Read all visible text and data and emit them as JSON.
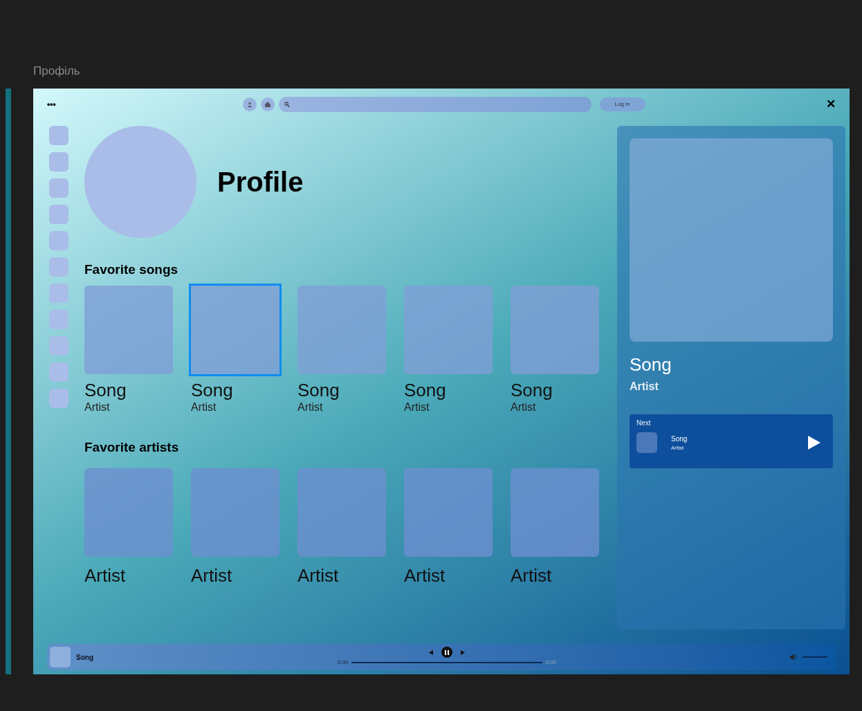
{
  "window": {
    "title": "Профіль"
  },
  "toolbar": {
    "menu": "•••",
    "login": "Log in",
    "close": "✕"
  },
  "sidebar": {
    "items": [
      {
        "selected": false
      },
      {
        "selected": false
      },
      {
        "selected": false
      },
      {
        "selected": false
      },
      {
        "selected": false
      },
      {
        "selected": false
      },
      {
        "selected": false
      },
      {
        "selected": false
      },
      {
        "selected": false
      },
      {
        "selected": false
      },
      {
        "selected": false
      }
    ]
  },
  "profile": {
    "title": "Profile"
  },
  "favorite_songs": {
    "heading": "Favorite songs",
    "items": [
      {
        "title": "Song",
        "artist": "Artist",
        "selected": false
      },
      {
        "title": "Song",
        "artist": "Artist",
        "selected": true
      },
      {
        "title": "Song",
        "artist": "Artist",
        "selected": false
      },
      {
        "title": "Song",
        "artist": "Artist",
        "selected": false
      },
      {
        "title": "Song",
        "artist": "Artist",
        "selected": false
      }
    ]
  },
  "favorite_artists": {
    "heading": "Favorite artists",
    "items": [
      {
        "name": "Artist"
      },
      {
        "name": "Artist"
      },
      {
        "name": "Artist"
      },
      {
        "name": "Artist"
      },
      {
        "name": "Artist"
      }
    ]
  },
  "now_playing": {
    "title": "Song",
    "artist": "Artist",
    "next": {
      "label": "Next",
      "title": "Song",
      "artist": "Artist"
    }
  },
  "player": {
    "title": "Song",
    "elapsed": "0:00",
    "total": "3:00",
    "level": 0,
    "playing": true,
    "volume": {
      "level": 1
    }
  }
}
